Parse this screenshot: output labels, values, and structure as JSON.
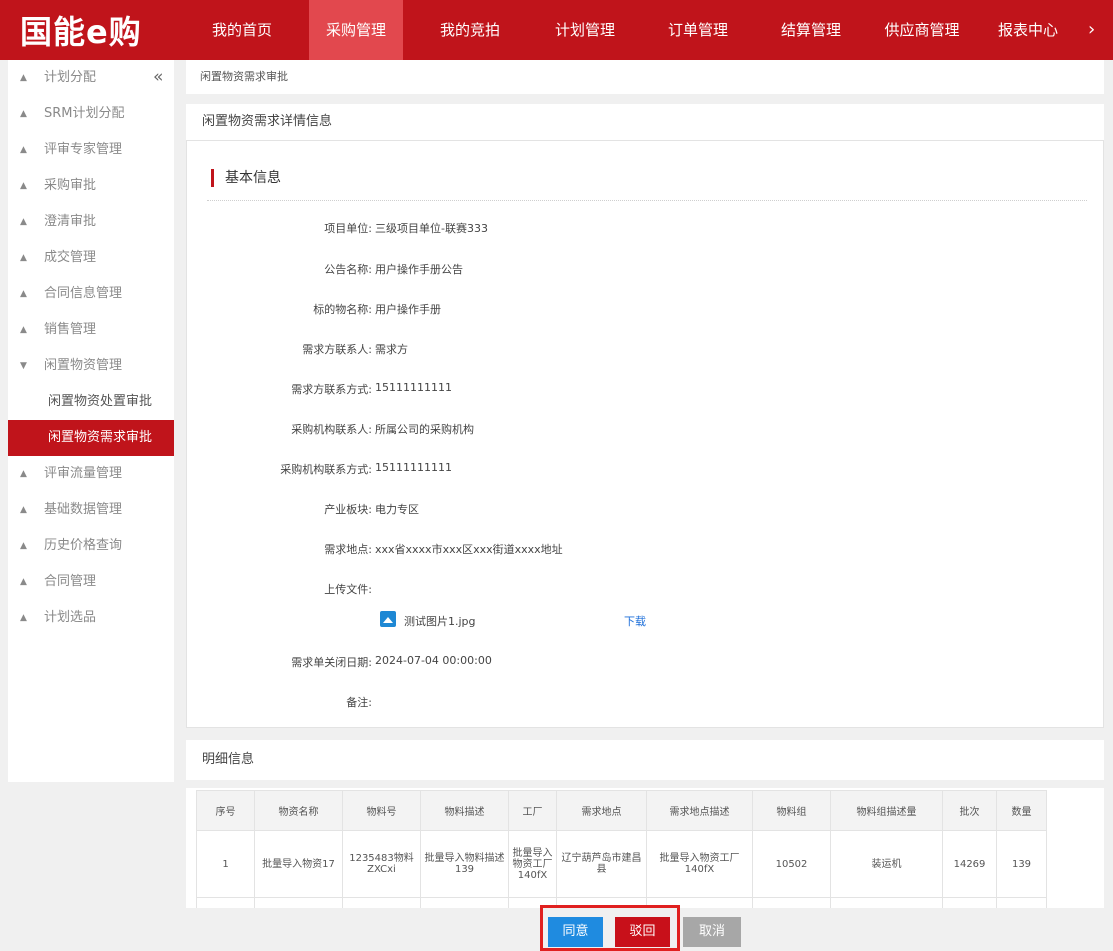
{
  "logo": {
    "text": "国能e购"
  },
  "nav": {
    "items": [
      "我的首页",
      "采购管理",
      "我的竞拍",
      "计划管理",
      "订单管理",
      "结算管理",
      "供应商管理",
      "报表中心"
    ],
    "active_index": 1,
    "more_icon": "chevron-right-icon"
  },
  "sidebar": {
    "collapse_icon": "double-chevron-left-icon",
    "items": [
      {
        "label": "计划分配",
        "type": "group"
      },
      {
        "label": "SRM计划分配",
        "type": "group"
      },
      {
        "label": "评审专家管理",
        "type": "group"
      },
      {
        "label": "采购审批",
        "type": "group"
      },
      {
        "label": "澄清审批",
        "type": "group"
      },
      {
        "label": "成交管理",
        "type": "group"
      },
      {
        "label": "合同信息管理",
        "type": "group"
      },
      {
        "label": "销售管理",
        "type": "group"
      },
      {
        "label": "闲置物资管理",
        "type": "group-open"
      },
      {
        "label": "闲置物资处置审批",
        "type": "sub"
      },
      {
        "label": "闲置物资需求审批",
        "type": "sub-active"
      },
      {
        "label": "评审流量管理",
        "type": "group"
      },
      {
        "label": "基础数据管理",
        "type": "group"
      },
      {
        "label": "历史价格查询",
        "type": "group"
      },
      {
        "label": "合同管理",
        "type": "group"
      },
      {
        "label": "计划选品",
        "type": "group"
      }
    ]
  },
  "breadcrumb": "闲置物资需求审批",
  "panel_title": "闲置物资需求详情信息",
  "basic_info": {
    "title": "基本信息",
    "fields": [
      {
        "label": "项目单位:",
        "value": "三级项目单位-联赛333"
      },
      {
        "label": "公告名称:",
        "value": "用户操作手册公告"
      },
      {
        "label": "标的物名称:",
        "value": "用户操作手册"
      },
      {
        "label": "需求方联系人:",
        "value": "需求方"
      },
      {
        "label": "需求方联系方式:",
        "value": "15111111111"
      },
      {
        "label": "采购机构联系人:",
        "value": "所属公司的采购机构"
      },
      {
        "label": "采购机构联系方式:",
        "value": "15111111111"
      },
      {
        "label": "产业板块:",
        "value": "电力专区"
      },
      {
        "label": "需求地点:",
        "value": "xxx省xxxx市xxx区xxx街道xxxx地址"
      },
      {
        "label": "上传文件:",
        "value": ""
      },
      {
        "label": "需求单关闭日期:",
        "value": "2024-07-04 00:00:00"
      },
      {
        "label": "备注:",
        "value": ""
      }
    ],
    "file": {
      "name": "测试图片1.jpg",
      "download": "下载",
      "icon": "image-file-icon"
    }
  },
  "detail_title": "明细信息",
  "table": {
    "headers": [
      "序号",
      "物资名称",
      "物料号",
      "物料描述",
      "工厂",
      "需求地点",
      "需求地点描述",
      "物料组",
      "物料组描述量",
      "批次",
      "数量"
    ],
    "rows": [
      [
        "1",
        "批量导入物资17",
        "1235483物料ZXCxi",
        "批量导入物料描述139",
        "批量导入物资工厂140fX",
        "辽宁葫芦岛市建昌县",
        "批量导入物资工厂140fX",
        "10502",
        "装运机",
        "14269",
        "139"
      ]
    ]
  },
  "actions": {
    "agree": "同意",
    "reject": "驳回",
    "cancel": "取消"
  }
}
